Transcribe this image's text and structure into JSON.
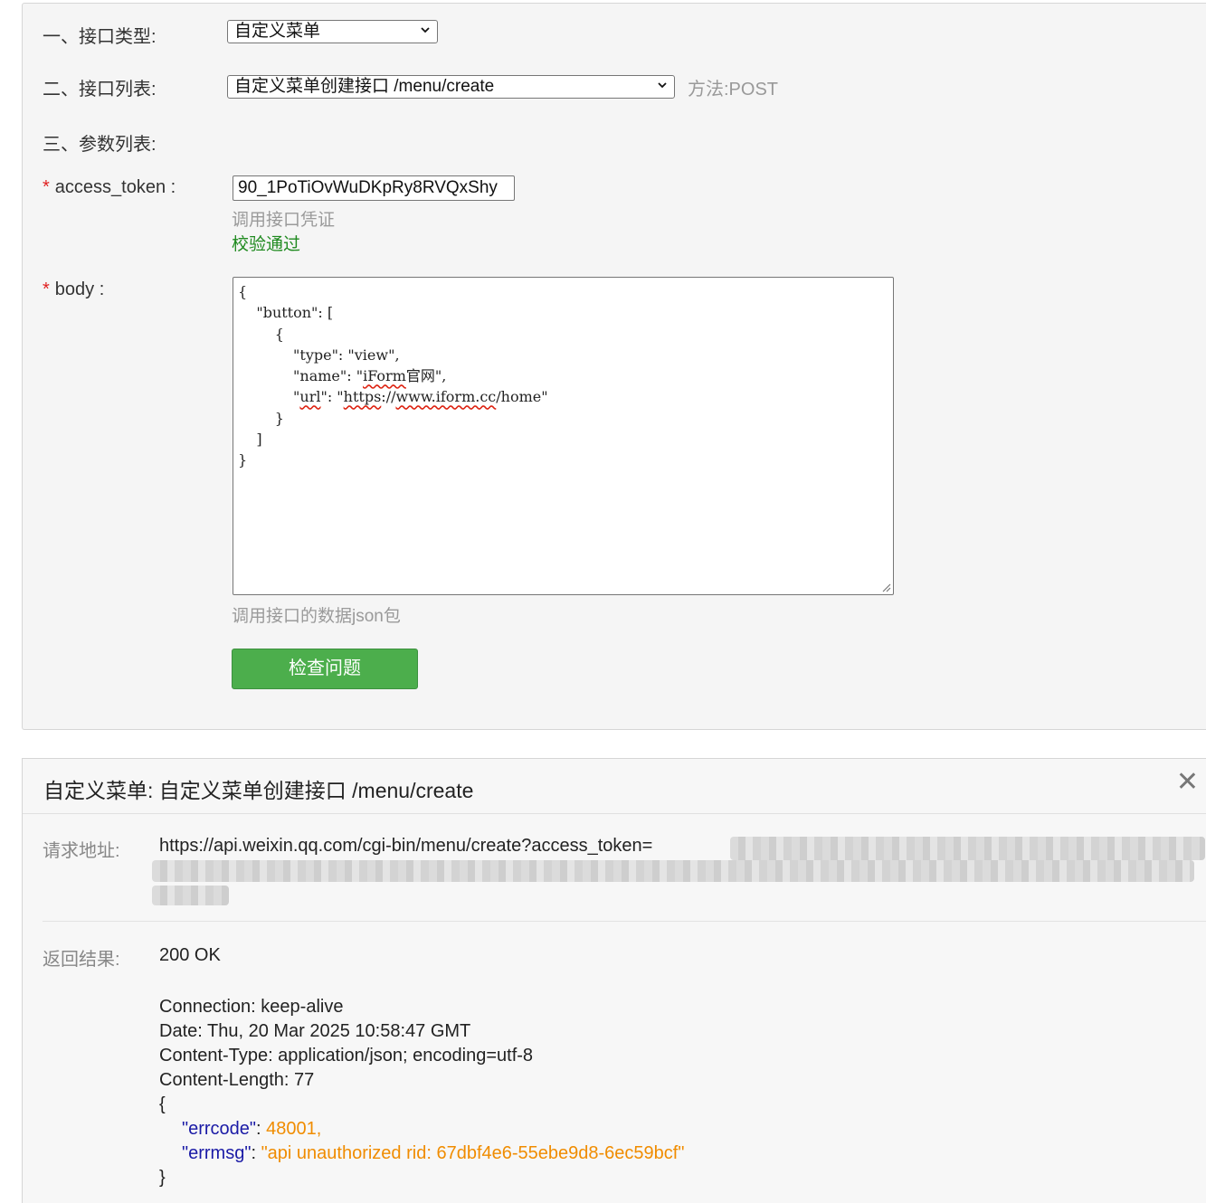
{
  "form": {
    "type_label": "一、接口类型:",
    "type_selected": "自定义菜单",
    "list_label": "二、接口列表:",
    "list_selected": "自定义菜单创建接口 /menu/create",
    "method_text": "方法:POST",
    "params_label": "三、参数列表:",
    "access_token_label": "access_token :",
    "required_mark": "*",
    "access_token_value": "90_1PoTiOvWuDKpRy8RVQxShy",
    "access_token_hint": "调用接口凭证",
    "access_token_status": "校验通过",
    "body_label": "body :",
    "body_hint": "调用接口的数据json包",
    "check_button": "检查问题",
    "body_lines": {
      "l1": "{",
      "l2": "    \"button\": [",
      "l3": "        {",
      "l4": "            \"type\": \"view\",",
      "l5a": "            \"name\": \"",
      "l5b": "iForm",
      "l5c": "官网\",",
      "l6a": "            \"",
      "l6b": "url",
      "l6c": "\": \"",
      "l6d": "https",
      "l6e": "://",
      "l6f": "www.iform.cc",
      "l6g": "/home\"",
      "l7": "        }",
      "l8": "    ]",
      "l9": "}"
    }
  },
  "result": {
    "title": "自定义菜单: 自定义菜单创建接口 /menu/create",
    "request_label": "请求地址:",
    "request_url": "https://api.weixin.qq.com/cgi-bin/menu/create?access_token=",
    "return_label": "返回结果:",
    "status": "200 OK",
    "headers": "Connection: keep-alive\nDate: Thu, 20 Mar 2025 10:58:47 GMT\nContent-Type: application/json; encoding=utf-8\nContent-Length: 77",
    "json_open": "{",
    "json_close": "}",
    "errcode_key": "\"errcode\"",
    "errcode_val": "48001,",
    "errmsg_key": "\"errmsg\"",
    "errmsg_val": "\"api unauthorized rid: 67dbf4e6-55ebe9d8-6ec59bcf\"",
    "colon": ": "
  },
  "icons": {
    "close": "close-icon",
    "dropdown": "chevron-down-icon",
    "resize": "resize-grip-icon"
  },
  "colors": {
    "button_green": "#4cae4c",
    "success_text": "#1f8a1f",
    "json_key": "#1a1aa6",
    "json_value": "#f08c00",
    "required": "#e02020"
  }
}
